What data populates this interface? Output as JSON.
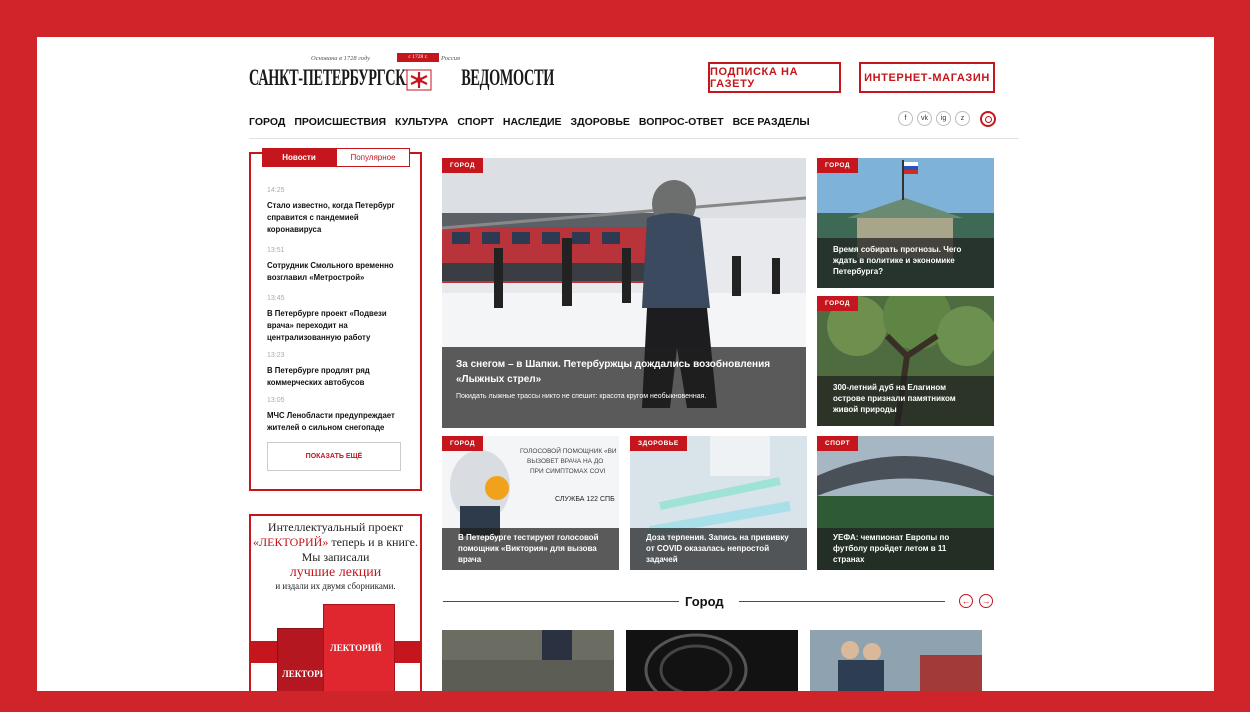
{
  "header": {
    "logo_small_left": "Основана в 1728 году",
    "logo_ribbon": "с 1728 г.",
    "logo_small_right": "Россия",
    "logo_text_left": "САНКТ-ПЕТЕРБУРГСКИЕ",
    "logo_text_right": "ВЕДОМОСТИ",
    "subscribe_label": "ПОДПИСКА НА ГАЗЕТУ",
    "shop_label": "ИНТЕРНЕТ-МАГАЗИН"
  },
  "nav": {
    "items": [
      "ГОРОД",
      "ПРОИСШЕСТВИЯ",
      "КУЛЬТУРА",
      "СПОРТ",
      "НАСЛЕДИЕ",
      "ЗДОРОВЬЕ",
      "ВОПРОС-ОТВЕТ",
      "ВСЕ РАЗДЕЛЫ"
    ],
    "social": [
      "f",
      "vk",
      "ig",
      "z"
    ]
  },
  "news_panel": {
    "tab_news": "Новости",
    "tab_popular": "Популярное",
    "items": [
      {
        "time": "14:25",
        "title": "Стало известно, когда Петербург справится с пандемией коронавируса"
      },
      {
        "time": "13:51",
        "title": "Сотрудник Смольного временно возглавил «Метрострой»"
      },
      {
        "time": "13:45",
        "title": "В Петербурге проект «Подвези врача» переходит на централизованную работу"
      },
      {
        "time": "13:23",
        "title": "В Петербурге продлят ряд коммерческих автобусов"
      },
      {
        "time": "13:05",
        "title": "МЧС Ленобласти предупреждает жителей о сильном снегопаде"
      }
    ],
    "show_more": "ПОКАЗАТЬ ЕЩЁ"
  },
  "promo": {
    "line1": "Интеллектуальный проект",
    "line2_red": "«ЛЕКТОРИЙ»",
    "line2_rest": " теперь и в книге.",
    "line3": "Мы записали",
    "line4": "лучшие лекции",
    "line5": "и издали их двумя сборниками.",
    "book_title": "ЛЕКТОРИЙ",
    "book_title_short": "ЛЕКТОРИ"
  },
  "cards": {
    "main": {
      "category": "ГОРОД",
      "title": "За снегом – в Шапки. Петербуржцы дождались возобновления «Лыжных стрел»",
      "subtitle": "Покидать лыжные трассы никто не спешит: красота кругом необыкновенная."
    },
    "r1": {
      "category": "ГОРОД",
      "title": "Время собирать прогнозы. Чего ждать в политике и экономике Петербурга?"
    },
    "r2": {
      "category": "ГОРОД",
      "title": "300-летний дуб на Елагином острове признали памятником живой природы"
    },
    "b1": {
      "category": "ГОРОД",
      "title": "В Петербурге тестируют голосовой помощник «Виктория» для вызова врача",
      "img_text1": "ГОЛОСОВОЙ ПОМОЩНИК «ВИ",
      "img_text2": "ВЫЗОВЕТ ВРАЧА НА ДО",
      "img_text3": "ПРИ СИМПТОМАХ COVI",
      "img_text4": "СЛУЖБА 122 СПБ"
    },
    "b2": {
      "category": "ЗДОРОВЬЕ",
      "title": "Доза терпения. Запись на прививку от COVID оказалась непростой задачей"
    },
    "b3": {
      "category": "СПОРТ",
      "title": "УЕФА: чемпионат Европы по футболу пройдет летом в 11 странах"
    }
  },
  "section": {
    "title": "Город",
    "prev": "←",
    "next": "→"
  }
}
